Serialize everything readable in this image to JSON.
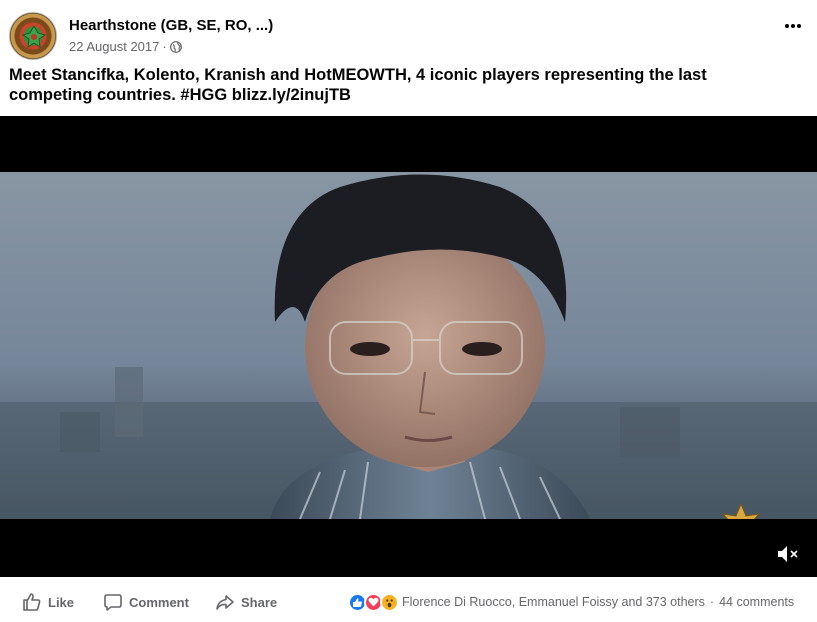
{
  "post": {
    "page_name": "Hearthstone (GB, SE, RO, ...)",
    "date": "22 August 2017",
    "separator": "·",
    "privacy_icon": "globe-icon",
    "more_icon": "more-options-icon",
    "text_line1": "Meet Stancifka, Kolento, Kranish and HotMEOWTH, 4 iconic players representing the last",
    "text_line2": "competing countries. #HGG blizz.ly/2inujTB"
  },
  "video": {
    "state": "muted",
    "watermark_icon": "hearthstone-global-games-logo",
    "mute_icon": "speaker-muted-icon"
  },
  "actions": {
    "like_label": "Like",
    "comment_label": "Comment",
    "share_label": "Share"
  },
  "reactions": {
    "types": [
      "like",
      "love",
      "wow"
    ],
    "reactors": "Florence Di Ruocco, Emmanuel Foissy and 373 others",
    "separator": "·",
    "comments": "44 comments"
  },
  "colors": {
    "text_primary": "#050505",
    "text_secondary": "#65676b",
    "like_blue": "#1877f2",
    "love_red": "#f33e58",
    "wow_yellow": "#f7b125"
  }
}
